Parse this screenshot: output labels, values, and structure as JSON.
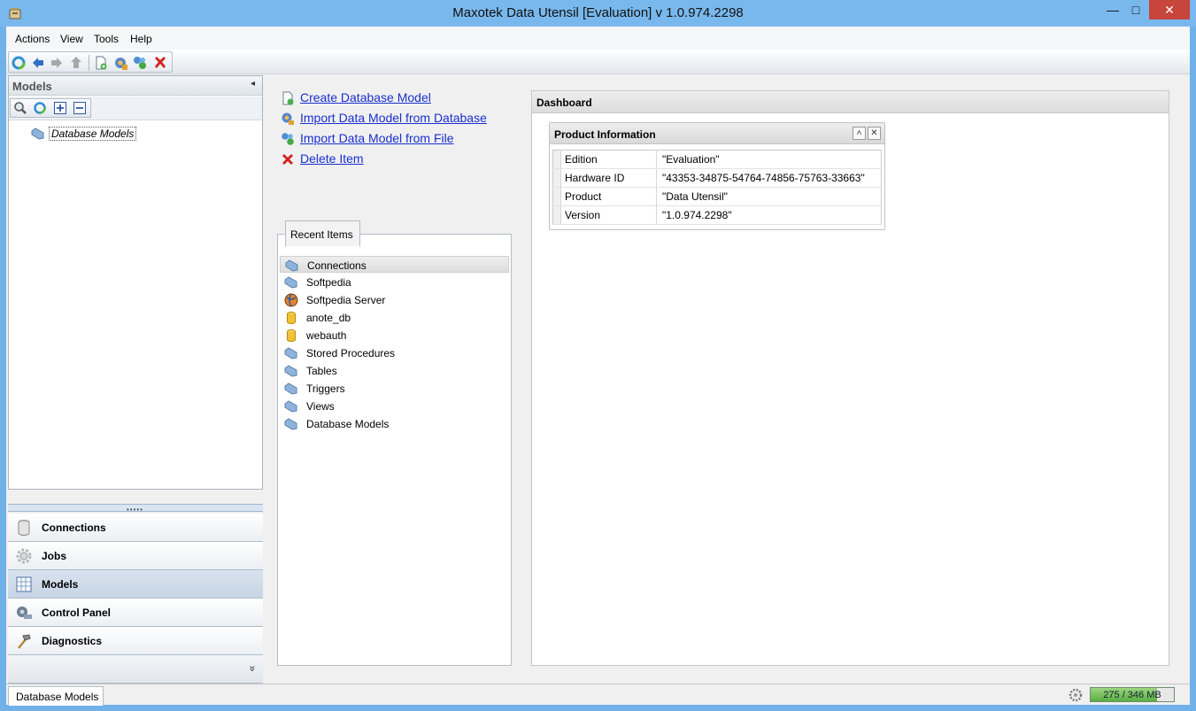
{
  "window": {
    "title": "Maxotek Data Utensil [Evaluation] v 1.0.974.2298",
    "minimize": "—",
    "maximize": "□",
    "close": "✕"
  },
  "menu": [
    "Actions",
    "View",
    "Tools",
    "Help"
  ],
  "toolbar": {
    "icons": [
      "refresh-icon",
      "back-arrow-icon",
      "forward-arrow-icon",
      "up-arrow-icon",
      "new-document-icon",
      "database-settings-icon",
      "puzzle-icon",
      "delete-icon"
    ]
  },
  "left_panel": {
    "title": "Models",
    "collapse_glyph": "◂",
    "tools": [
      "search-icon",
      "refresh-icon",
      "expand-all-icon",
      "collapse-all-icon"
    ],
    "tree": [
      {
        "label": "Database Models",
        "icon": "tag-icon"
      }
    ]
  },
  "splitter": {
    "grip": "•••••"
  },
  "nav": {
    "items": [
      {
        "label": "Connections",
        "icon": "database-icon",
        "active": false
      },
      {
        "label": "Jobs",
        "icon": "gear-icon",
        "active": false
      },
      {
        "label": "Models",
        "icon": "grid-icon",
        "active": true
      },
      {
        "label": "Control Panel",
        "icon": "control-panel-icon",
        "active": false
      },
      {
        "label": "Diagnostics",
        "icon": "hammer-icon",
        "active": false
      }
    ],
    "more_glyph": "»"
  },
  "actions": [
    {
      "label": "Create Database Model",
      "icon": "new-model-icon"
    },
    {
      "label": "Import Data Model from Database",
      "icon": "import-database-icon"
    },
    {
      "label": "Import Data Model from File",
      "icon": "import-file-icon"
    },
    {
      "label": "Delete Item",
      "icon": "delete-icon"
    }
  ],
  "recent": {
    "tab_label": "Recent Items",
    "items": [
      {
        "label": "Connections",
        "icon": "tag-icon",
        "selected": true
      },
      {
        "label": "Softpedia",
        "icon": "tag-icon",
        "selected": false
      },
      {
        "label": "Softpedia Server",
        "icon": "server-globe-icon",
        "selected": false
      },
      {
        "label": "anote_db",
        "icon": "database-cylinder-icon",
        "selected": false
      },
      {
        "label": "webauth",
        "icon": "database-cylinder-icon",
        "selected": false
      },
      {
        "label": "Stored Procedures",
        "icon": "tag-icon",
        "selected": false
      },
      {
        "label": "Tables",
        "icon": "tag-icon",
        "selected": false
      },
      {
        "label": "Triggers",
        "icon": "tag-icon",
        "selected": false
      },
      {
        "label": "Views",
        "icon": "tag-icon",
        "selected": false
      },
      {
        "label": "Database Models",
        "icon": "tag-icon",
        "selected": false
      }
    ]
  },
  "dashboard": {
    "title": "Dashboard",
    "product": {
      "title": "Product Information",
      "collapse_glyph": "˄",
      "close_glyph": "✕",
      "rows": [
        {
          "key": "Edition",
          "value": "\"Evaluation\""
        },
        {
          "key": "Hardware ID",
          "value": "\"43353-34875-54764-74856-75763-33663\""
        },
        {
          "key": "Product",
          "value": "\"Data Utensil\""
        },
        {
          "key": "Version",
          "value": "\"1.0.974.2298\""
        }
      ]
    }
  },
  "status": {
    "tab_label": "Database Models",
    "memory_text": "275 / 346 MB",
    "memory_fraction": 0.795
  },
  "colors": {
    "title_bar": "#79b8ed",
    "close_button": "#c7453b",
    "link": "#1a2fcf",
    "memory_fill": "#5cad43"
  }
}
